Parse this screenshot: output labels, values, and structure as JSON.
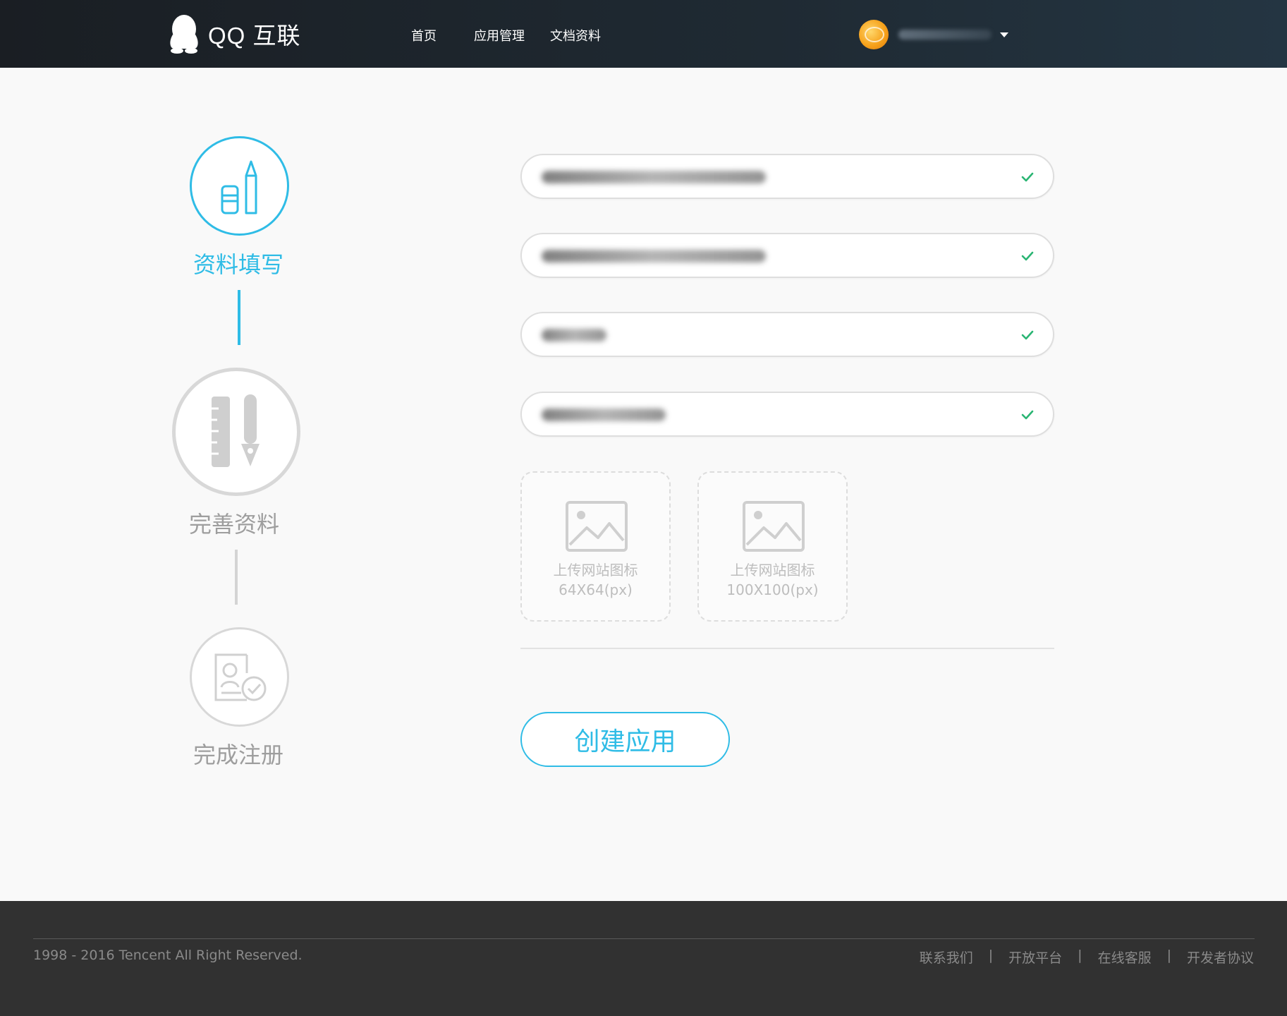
{
  "header": {
    "logo_text": "QQ 互联",
    "nav": [
      {
        "label": "首页"
      },
      {
        "label": "应用管理"
      },
      {
        "label": "文档资料"
      }
    ]
  },
  "steps": [
    {
      "label": "资料填写",
      "icon": "pencil-eraser-icon",
      "state": "active"
    },
    {
      "label": "完善资料",
      "icon": "ruler-pen-icon",
      "state": "current-large"
    },
    {
      "label": "完成注册",
      "icon": "id-card-check-icon",
      "state": "pending"
    }
  ],
  "form": {
    "uploads": [
      {
        "label": "上传网站图标",
        "size": "64X64(px)"
      },
      {
        "label": "上传网站图标",
        "size": "100X100(px)"
      }
    ],
    "submit_label": "创建应用"
  },
  "footer": {
    "copyright": "1998 - 2016 Tencent All Right Reserved.",
    "links": [
      {
        "label": "联系我们"
      },
      {
        "label": "开放平台"
      },
      {
        "label": "在线客服"
      },
      {
        "label": "开发者协议"
      }
    ],
    "separator": "|"
  },
  "colors": {
    "accent": "#2fbce6",
    "valid": "#2ab573",
    "inactive": "#d4d4d4",
    "header_bg": "#1f2a33",
    "footer_bg": "#313131"
  }
}
